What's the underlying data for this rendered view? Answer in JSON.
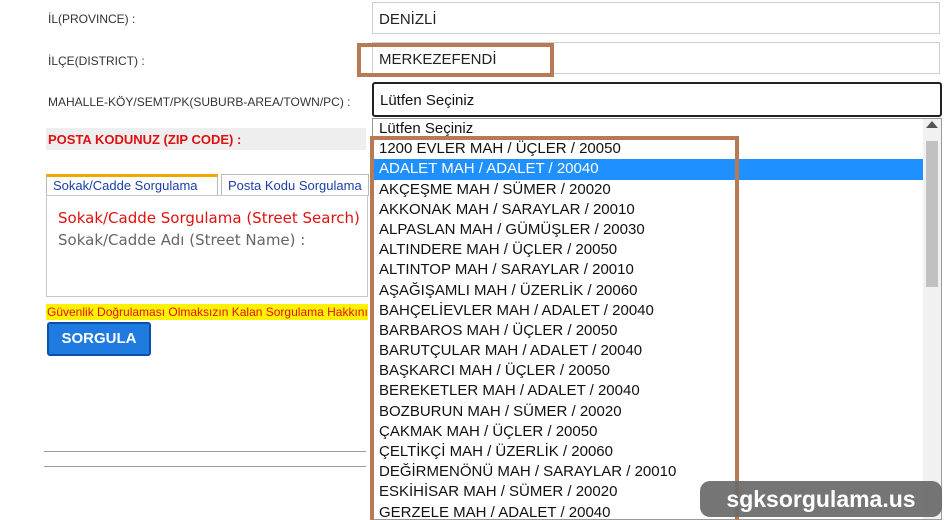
{
  "form": {
    "province_label": "İL(PROVINCE) :",
    "province_value": "DENİZLİ",
    "district_label": "İLÇE(DISTRICT) :",
    "district_value": "MERKEZEFENDİ",
    "neighborhood_label": "MAHALLE-KÖY/SEMT/PK(SUBURB-AREA/TOWN/PC) :",
    "neighborhood_selected": "Lütfen Seçiniz",
    "zip_label": "POSTA KODUNUZ (ZIP CODE) :"
  },
  "tabs": [
    {
      "label": "Sokak/Cadde Sorgulama"
    },
    {
      "label": "Posta Kodu Sorgulama"
    }
  ],
  "panel": {
    "title": "Sokak/Cadde Sorgulama (Street Search)",
    "field_label": "Sokak/Cadde Adı (Street Name) :"
  },
  "warning_text": "Güvenlik Doğrulaması Olmaksızın Kalan Sorgulama Hakkınız",
  "submit_label": "SORGULA",
  "dropdown": {
    "options": [
      "Lütfen Seçiniz",
      "1200 EVLER MAH / ÜÇLER / 20050",
      "ADALET MAH / ADALET / 20040",
      "AKÇEŞME MAH / SÜMER / 20020",
      "AKKONAK MAH / SARAYLAR / 20010",
      "ALPASLAN MAH / GÜMÜŞLER / 20030",
      "ALTINDERE MAH / ÜÇLER / 20050",
      "ALTINTOP MAH / SARAYLAR / 20010",
      "AŞAĞIŞAMLI MAH / ÜZERLİK / 20060",
      "BAHÇELİEVLER MAH / ADALET / 20040",
      "BARBAROS MAH / ÜÇLER / 20050",
      "BARUTÇULAR MAH / ADALET / 20040",
      "BAŞKARCI MAH / ÜÇLER / 20050",
      "BEREKETLER MAH / ADALET / 20040",
      "BOZBURUN MAH / SÜMER / 20020",
      "ÇAKMAK MAH / ÜÇLER / 20050",
      "ÇELTİKÇİ MAH / ÜZERLİK / 20060",
      "DEĞİRMENÖNÜ MAH / SARAYLAR / 20010",
      "ESKİHİSAR MAH / SÜMER / 20020",
      "GERZELE MAH / ADALET / 20040"
    ],
    "highlighted": "ADALET MAH / ADALET / 20040"
  },
  "watermark": "sgksorgulama.us",
  "colors": {
    "annotation": "#b77a54",
    "selected_option": "#1e90ff",
    "warning_bg": "#fff200",
    "button": "#1f7be0",
    "label_red": "#e01010"
  }
}
